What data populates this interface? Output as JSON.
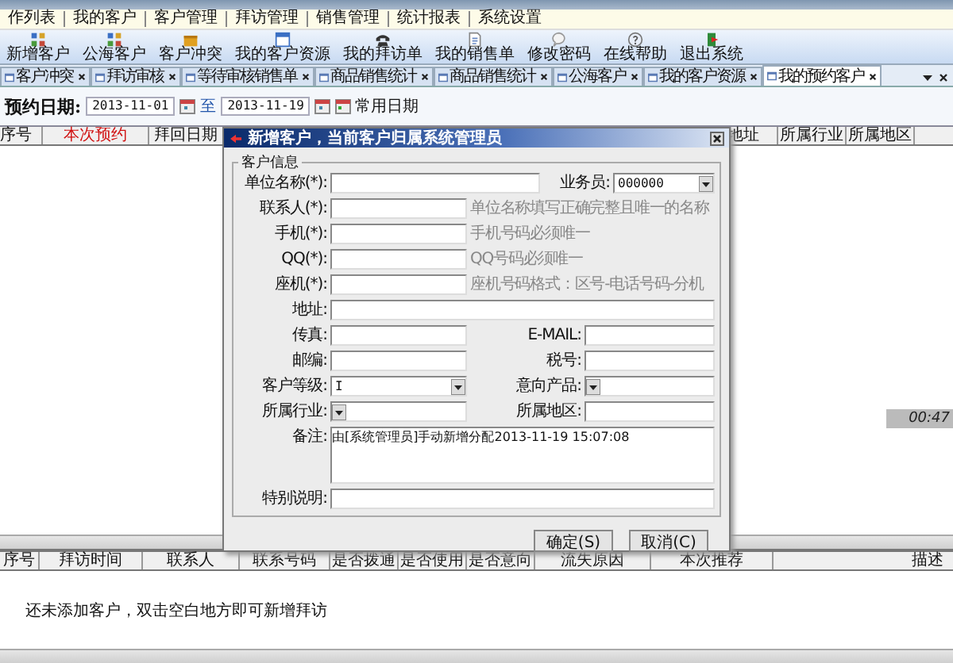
{
  "menu": [
    "作列表",
    "我的客户",
    "客户管理",
    "拜访管理",
    "销售管理",
    "统计报表",
    "系统设置"
  ],
  "toolbar": [
    "新增客户",
    "公海客户",
    "客户冲突",
    "我的客户资源",
    "我的拜访单",
    "我的销售单",
    "修改密码",
    "在线帮助",
    "退出系统"
  ],
  "tabs": [
    {
      "label": "客户冲突",
      "selected": false
    },
    {
      "label": "拜访审核",
      "selected": false
    },
    {
      "label": "等待审核销售单",
      "selected": false
    },
    {
      "label": "商品销售统计",
      "selected": false
    },
    {
      "label": "商品销售统计",
      "selected": false
    },
    {
      "label": "公海客户",
      "selected": false
    },
    {
      "label": "我的客户资源",
      "selected": false
    },
    {
      "label": "我的预约客户",
      "selected": true
    }
  ],
  "filter": {
    "label": "预约日期:",
    "from": "2013-11-01",
    "separator": "至",
    "to": "2013-11-19",
    "preset": "常用日期"
  },
  "upper_table": {
    "columns": [
      {
        "label": "序号",
        "emphasized": false
      },
      {
        "label": "本次预约",
        "emphasized": true
      },
      {
        "label": "拜回日期",
        "emphasized": false
      }
    ],
    "right_columns": [
      "地址",
      "所属行业",
      "所属地区"
    ],
    "timer": "00:47"
  },
  "dialog": {
    "title": "新增客户，当前客户归属系统管理员",
    "group": "客户信息",
    "rows": [
      {
        "kind": "lead",
        "fields": [
          {
            "label": "单位名称(*):",
            "kind": "input"
          },
          {
            "label": "业务员:",
            "kind": "select",
            "value": "000000"
          }
        ]
      },
      {
        "kind": "hint",
        "fields": [
          {
            "label": "联系人(*):",
            "kind": "input"
          }
        ],
        "hint": "单位名称填写正确完整且唯一的名称"
      },
      {
        "kind": "hint",
        "fields": [
          {
            "label": "手机(*):",
            "kind": "input"
          }
        ],
        "hint": "手机号码必须唯一"
      },
      {
        "kind": "hint",
        "fields": [
          {
            "label": "QQ(*):",
            "kind": "input"
          }
        ],
        "hint": "QQ号码必须唯一"
      },
      {
        "kind": "hint",
        "fields": [
          {
            "label": "座机(*):",
            "kind": "input"
          }
        ],
        "hint": "座机号码格式：区号-电话号码-分机"
      },
      {
        "kind": "full",
        "fields": [
          {
            "label": "地址:",
            "kind": "input"
          }
        ]
      },
      {
        "kind": "pair",
        "fields": [
          {
            "label": "传真:",
            "kind": "input"
          },
          {
            "label": "E-MAIL:",
            "kind": "input"
          }
        ]
      },
      {
        "kind": "pair",
        "fields": [
          {
            "label": "邮编:",
            "kind": "input"
          },
          {
            "label": "税号:",
            "kind": "input"
          }
        ]
      },
      {
        "kind": "pair",
        "fields": [
          {
            "label": "客户等级:",
            "kind": "select",
            "value": "I"
          },
          {
            "label": "意向产品:",
            "kind": "select"
          }
        ]
      },
      {
        "kind": "pair",
        "fields": [
          {
            "label": "所属行业:",
            "kind": "select"
          },
          {
            "label": "所属地区:",
            "kind": "input"
          }
        ]
      },
      {
        "kind": "area",
        "fields": [
          {
            "label": "备注:",
            "kind": "input",
            "value": "由[系统管理员]手动新增分配2013-11-19 15:07:08"
          }
        ]
      },
      {
        "kind": "full",
        "fields": [
          {
            "label": "特别说明:",
            "kind": "input"
          }
        ]
      }
    ],
    "buttons": [
      "确定(S)",
      "取消(C)"
    ]
  },
  "lower_table": {
    "columns": [
      "序号",
      "拜访时间",
      "联系人",
      "联系号码",
      "是否拨通",
      "是否使用",
      "是否意向",
      "流失原因",
      "本次推荐",
      "描述"
    ],
    "empty_message": "还未添加客户，双击空白地方即可新增拜访"
  }
}
